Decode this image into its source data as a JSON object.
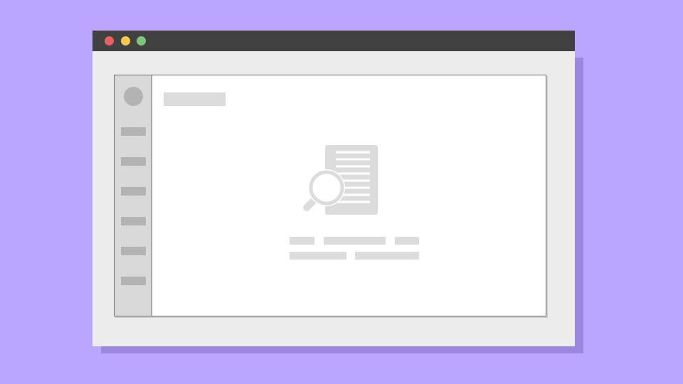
{
  "window": {
    "title": "",
    "controls": [
      "close",
      "minimize",
      "maximize"
    ]
  },
  "sidebar": {
    "avatar_icon": "avatar-placeholder",
    "items": [
      {
        "label": ""
      },
      {
        "label": ""
      },
      {
        "label": ""
      },
      {
        "label": ""
      },
      {
        "label": ""
      },
      {
        "label": ""
      }
    ]
  },
  "main": {
    "title": "",
    "empty_state": {
      "icon": "document-search-icon",
      "message_line_1": "",
      "message_line_2": ""
    }
  },
  "colors": {
    "background": "#bba6ff",
    "titlebar": "#414141",
    "close": "#ec5f5f",
    "minimize": "#f5c94f",
    "maximize": "#7ec77a",
    "placeholder": "#dcdcdc"
  }
}
